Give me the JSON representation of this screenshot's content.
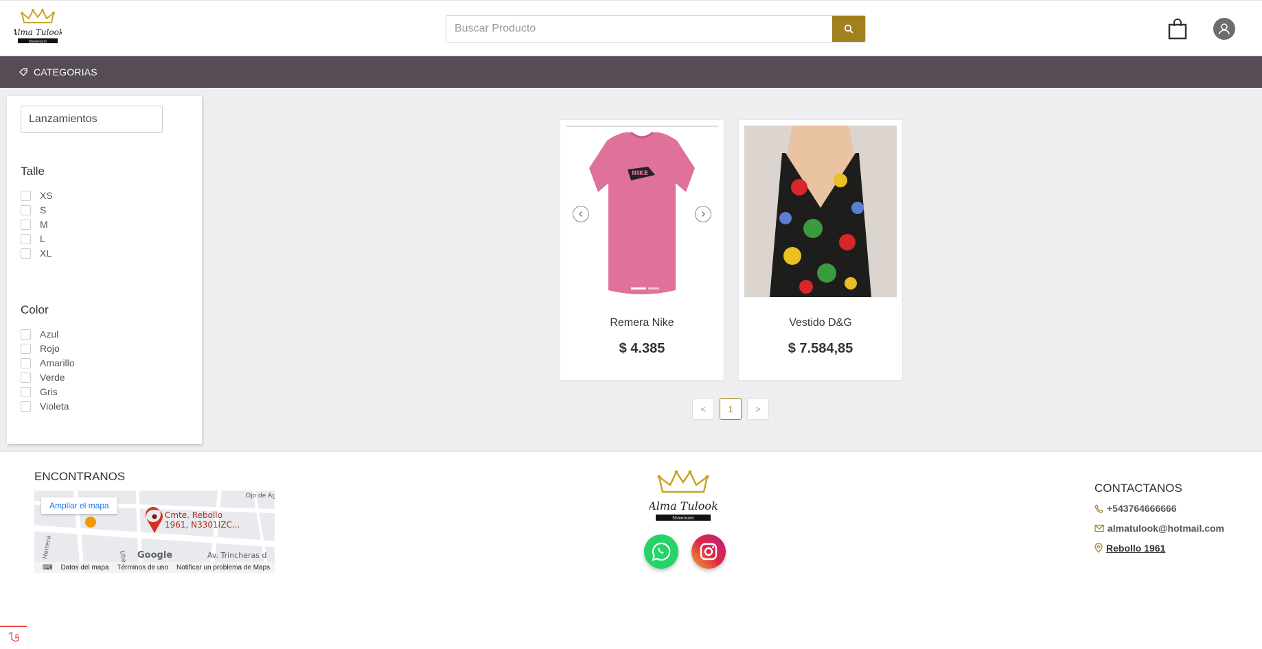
{
  "header": {
    "search_placeholder": "Buscar Producto",
    "brand": "Alma Tulook",
    "brand_sub": "Showroom"
  },
  "categories_bar": {
    "label": "CATEGORIAS"
  },
  "sidebar": {
    "select_value": "Lanzamientos",
    "size_title": "Talle",
    "sizes": [
      "XS",
      "S",
      "M",
      "L",
      "XL"
    ],
    "color_title": "Color",
    "colors": [
      "Azul",
      "Rojo",
      "Amarillo",
      "Verde",
      "Gris",
      "Violeta"
    ]
  },
  "products": [
    {
      "name": "Remera Nike",
      "price": "$ 4.385"
    },
    {
      "name": "Vestido D&G",
      "price": "$ 7.584,85"
    }
  ],
  "pagination": {
    "prev": "<",
    "current": "1",
    "next": ">"
  },
  "footer": {
    "find_title": "ENCONTRANOS",
    "map": {
      "enlarge": "Ampliar el mapa",
      "pin_label_1": "Cmte. Rebollo",
      "pin_label_2": "1961, N3301IZC...",
      "street_1": "Av. Trincheras d",
      "street_2": "Ojo de Ag",
      "street_3": "Herrera",
      "street_4": "Ubano",
      "google": "Google",
      "data": "Datos del mapa",
      "terms": "Términos de uso",
      "report": "Notificar un problema de Maps"
    },
    "contact_title": "CONTACTANOS",
    "phone": "+543764666666",
    "email": "almatulook@hotmail.com",
    "address": "Rebollo 1961"
  },
  "colors": {
    "accent": "#a0801f",
    "category_bar": "#564c55",
    "whatsapp": "#25d366",
    "instagram": "#e1306c"
  }
}
